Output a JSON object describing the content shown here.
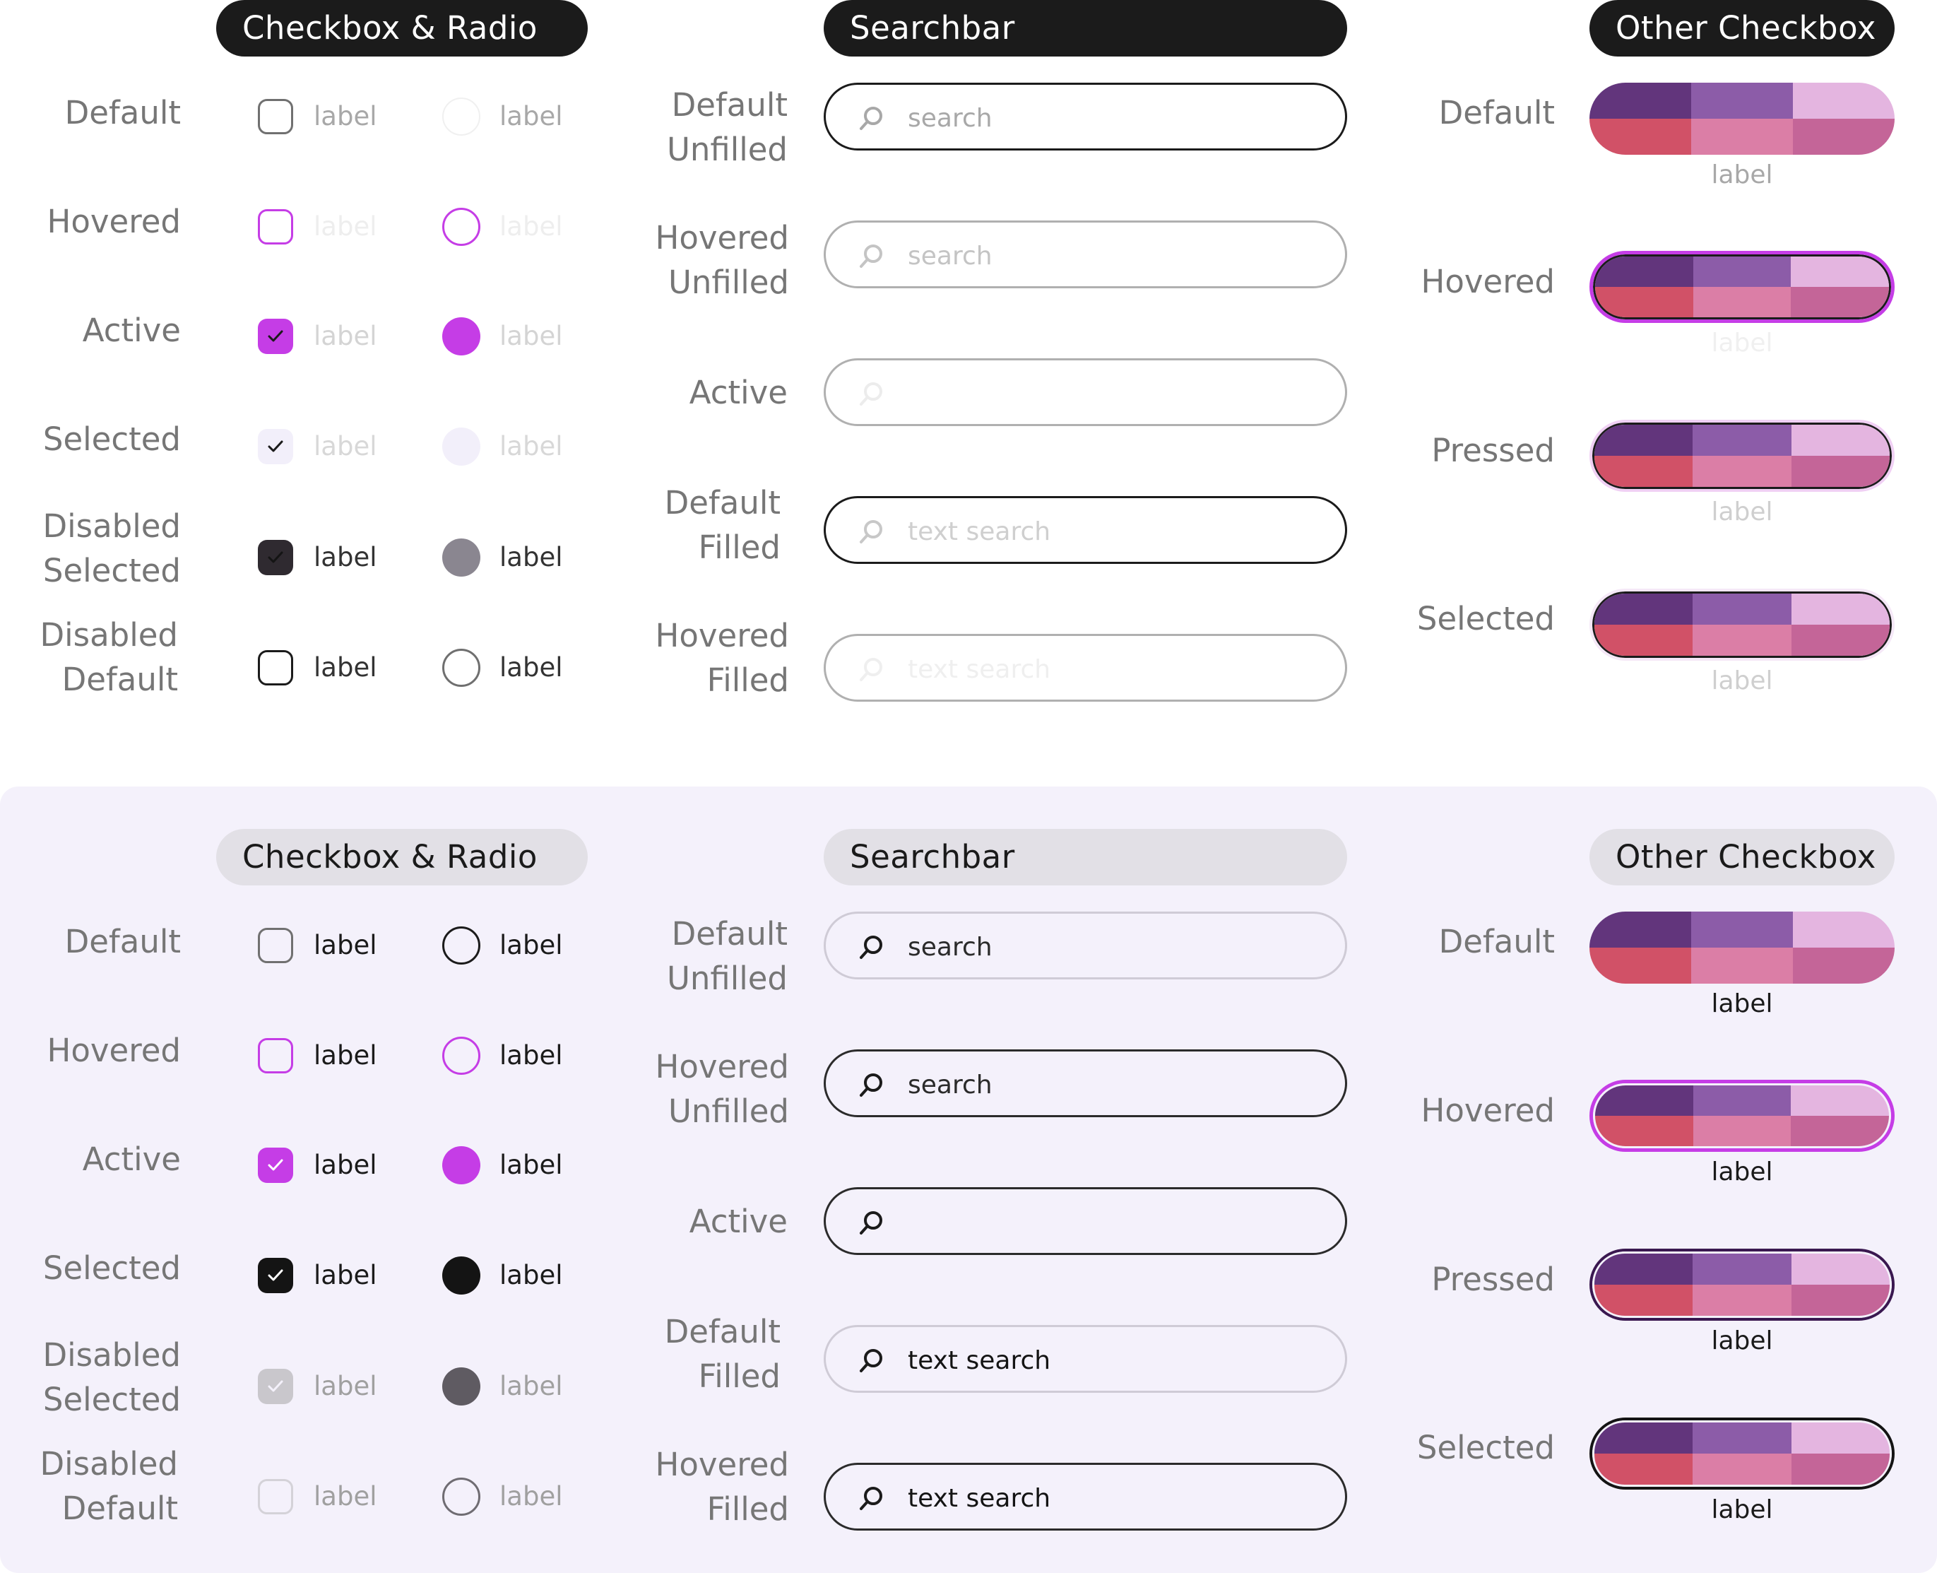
{
  "colors": {
    "accent": "#c53de6",
    "swatch": [
      "#62357c",
      "#8c5ca8",
      "#e4b5e0",
      "#d15167",
      "#db7ea6",
      "#c46598"
    ]
  },
  "top": {
    "headers": {
      "checkbox_radio": "Checkbox & Radio",
      "searchbar": "Searchbar",
      "other_checkbox": "Other Checkbox"
    },
    "checkbox_states": [
      "Default",
      "Hovered",
      "Active",
      "Selected",
      "Disabled\nSelected",
      "Disabled\nDefault"
    ],
    "option_label": "label",
    "search_states": [
      "Default\nUnfilled",
      "Hovered\nUnfilled",
      "Active",
      "Default\nFilled",
      "Hovered\nFilled"
    ],
    "search_values": [
      "search",
      "search",
      "",
      "text search",
      "text search"
    ],
    "other_states": [
      "Default",
      "Hovered",
      "Pressed",
      "Selected"
    ]
  },
  "bottom": {
    "headers": {
      "checkbox_radio": "Checkbox & Radio",
      "searchbar": "Searchbar",
      "other_checkbox": "Other Checkbox"
    },
    "checkbox_states": [
      "Default",
      "Hovered",
      "Active",
      "Selected",
      "Disabled\nSelected",
      "Disabled\nDefault"
    ],
    "option_label": "label",
    "search_states": [
      "Default\nUnfilled",
      "Hovered\nUnfilled",
      "Active",
      "Default\nFilled",
      "Hovered\nFilled"
    ],
    "search_values": [
      "search",
      "search",
      "",
      "text search",
      "text search"
    ],
    "other_states": [
      "Default",
      "Hovered",
      "Pressed",
      "Selected"
    ]
  }
}
